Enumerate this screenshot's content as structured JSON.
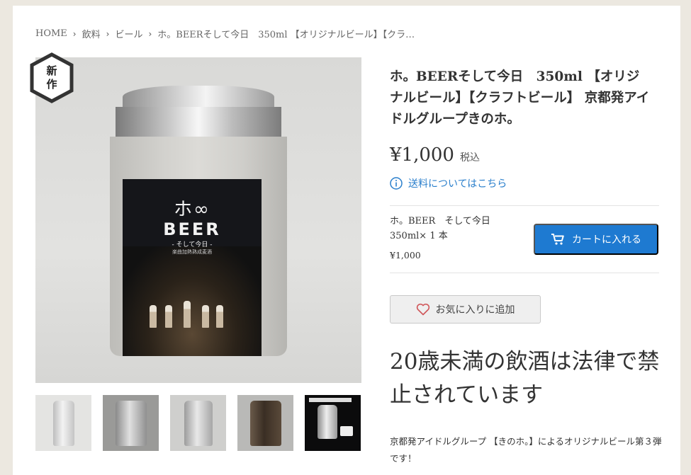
{
  "breadcrumb": {
    "items": [
      "HOME",
      "飲料",
      "ビール",
      "ホ。BEERそして今日　350ml 【オリジナルビール】【クラ…"
    ]
  },
  "badge": {
    "line1": "新",
    "line2": "作"
  },
  "can_label": {
    "mark": "ホ∞",
    "brand": "BEER",
    "subtitle": "- そして今日 -",
    "note": "楽曲加熱熟成麦酒"
  },
  "product": {
    "title": "ホ。BEERそして今日　350ml 【オリジナルビール】【クラフトビール】 京都発アイドルグループきのホ。",
    "price": "¥1,000",
    "tax_label": "税込",
    "shipping_link": "送料についてはこちら"
  },
  "variant": {
    "name": "ホ。BEER　そして今日　350ml× 1 本",
    "price": "¥1,000"
  },
  "buttons": {
    "cart": "カートに入れる",
    "favorite": "お気に入りに追加"
  },
  "warning": "20歳未満の飲酒は法律で禁止されています",
  "description": "京都発アイドルグループ 【きのホ。】によるオリジナルビール第３弾です！",
  "thumbnails": [
    "thumb-1",
    "thumb-2",
    "thumb-3",
    "thumb-4",
    "thumb-5"
  ],
  "colors": {
    "accent": "#1e7ad1",
    "link": "#2a7fcc",
    "page_bg": "#ece8e0"
  },
  "icons": [
    "chevron-right-icon",
    "info-icon",
    "cart-icon",
    "heart-icon",
    "new-badge-icon"
  ]
}
